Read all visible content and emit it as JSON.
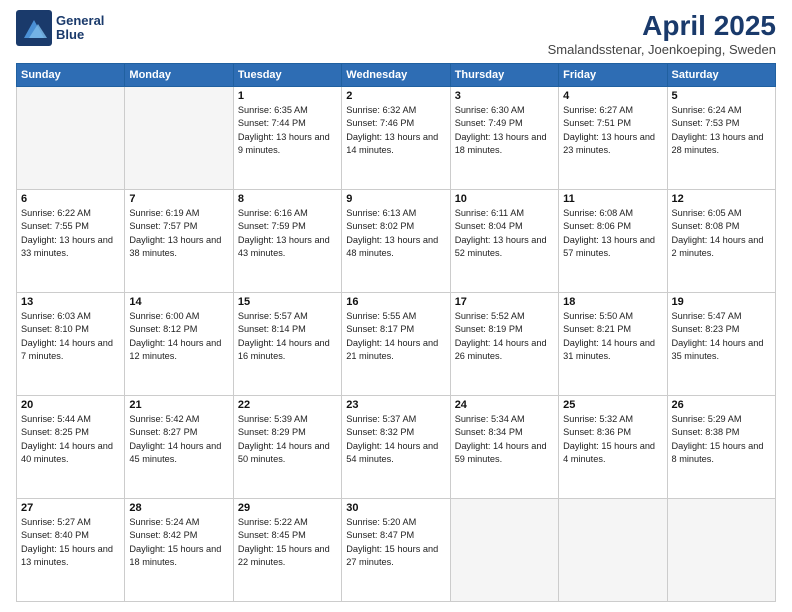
{
  "header": {
    "logo_line1": "General",
    "logo_line2": "Blue",
    "title": "April 2025",
    "subtitle": "Smalandsstenar, Joenkoeping, Sweden"
  },
  "columns": [
    "Sunday",
    "Monday",
    "Tuesday",
    "Wednesday",
    "Thursday",
    "Friday",
    "Saturday"
  ],
  "weeks": [
    [
      {
        "day": "",
        "info": ""
      },
      {
        "day": "",
        "info": ""
      },
      {
        "day": "1",
        "info": "Sunrise: 6:35 AM\nSunset: 7:44 PM\nDaylight: 13 hours and 9 minutes."
      },
      {
        "day": "2",
        "info": "Sunrise: 6:32 AM\nSunset: 7:46 PM\nDaylight: 13 hours and 14 minutes."
      },
      {
        "day": "3",
        "info": "Sunrise: 6:30 AM\nSunset: 7:49 PM\nDaylight: 13 hours and 18 minutes."
      },
      {
        "day": "4",
        "info": "Sunrise: 6:27 AM\nSunset: 7:51 PM\nDaylight: 13 hours and 23 minutes."
      },
      {
        "day": "5",
        "info": "Sunrise: 6:24 AM\nSunset: 7:53 PM\nDaylight: 13 hours and 28 minutes."
      }
    ],
    [
      {
        "day": "6",
        "info": "Sunrise: 6:22 AM\nSunset: 7:55 PM\nDaylight: 13 hours and 33 minutes."
      },
      {
        "day": "7",
        "info": "Sunrise: 6:19 AM\nSunset: 7:57 PM\nDaylight: 13 hours and 38 minutes."
      },
      {
        "day": "8",
        "info": "Sunrise: 6:16 AM\nSunset: 7:59 PM\nDaylight: 13 hours and 43 minutes."
      },
      {
        "day": "9",
        "info": "Sunrise: 6:13 AM\nSunset: 8:02 PM\nDaylight: 13 hours and 48 minutes."
      },
      {
        "day": "10",
        "info": "Sunrise: 6:11 AM\nSunset: 8:04 PM\nDaylight: 13 hours and 52 minutes."
      },
      {
        "day": "11",
        "info": "Sunrise: 6:08 AM\nSunset: 8:06 PM\nDaylight: 13 hours and 57 minutes."
      },
      {
        "day": "12",
        "info": "Sunrise: 6:05 AM\nSunset: 8:08 PM\nDaylight: 14 hours and 2 minutes."
      }
    ],
    [
      {
        "day": "13",
        "info": "Sunrise: 6:03 AM\nSunset: 8:10 PM\nDaylight: 14 hours and 7 minutes."
      },
      {
        "day": "14",
        "info": "Sunrise: 6:00 AM\nSunset: 8:12 PM\nDaylight: 14 hours and 12 minutes."
      },
      {
        "day": "15",
        "info": "Sunrise: 5:57 AM\nSunset: 8:14 PM\nDaylight: 14 hours and 16 minutes."
      },
      {
        "day": "16",
        "info": "Sunrise: 5:55 AM\nSunset: 8:17 PM\nDaylight: 14 hours and 21 minutes."
      },
      {
        "day": "17",
        "info": "Sunrise: 5:52 AM\nSunset: 8:19 PM\nDaylight: 14 hours and 26 minutes."
      },
      {
        "day": "18",
        "info": "Sunrise: 5:50 AM\nSunset: 8:21 PM\nDaylight: 14 hours and 31 minutes."
      },
      {
        "day": "19",
        "info": "Sunrise: 5:47 AM\nSunset: 8:23 PM\nDaylight: 14 hours and 35 minutes."
      }
    ],
    [
      {
        "day": "20",
        "info": "Sunrise: 5:44 AM\nSunset: 8:25 PM\nDaylight: 14 hours and 40 minutes."
      },
      {
        "day": "21",
        "info": "Sunrise: 5:42 AM\nSunset: 8:27 PM\nDaylight: 14 hours and 45 minutes."
      },
      {
        "day": "22",
        "info": "Sunrise: 5:39 AM\nSunset: 8:29 PM\nDaylight: 14 hours and 50 minutes."
      },
      {
        "day": "23",
        "info": "Sunrise: 5:37 AM\nSunset: 8:32 PM\nDaylight: 14 hours and 54 minutes."
      },
      {
        "day": "24",
        "info": "Sunrise: 5:34 AM\nSunset: 8:34 PM\nDaylight: 14 hours and 59 minutes."
      },
      {
        "day": "25",
        "info": "Sunrise: 5:32 AM\nSunset: 8:36 PM\nDaylight: 15 hours and 4 minutes."
      },
      {
        "day": "26",
        "info": "Sunrise: 5:29 AM\nSunset: 8:38 PM\nDaylight: 15 hours and 8 minutes."
      }
    ],
    [
      {
        "day": "27",
        "info": "Sunrise: 5:27 AM\nSunset: 8:40 PM\nDaylight: 15 hours and 13 minutes."
      },
      {
        "day": "28",
        "info": "Sunrise: 5:24 AM\nSunset: 8:42 PM\nDaylight: 15 hours and 18 minutes."
      },
      {
        "day": "29",
        "info": "Sunrise: 5:22 AM\nSunset: 8:45 PM\nDaylight: 15 hours and 22 minutes."
      },
      {
        "day": "30",
        "info": "Sunrise: 5:20 AM\nSunset: 8:47 PM\nDaylight: 15 hours and 27 minutes."
      },
      {
        "day": "",
        "info": ""
      },
      {
        "day": "",
        "info": ""
      },
      {
        "day": "",
        "info": ""
      }
    ]
  ]
}
